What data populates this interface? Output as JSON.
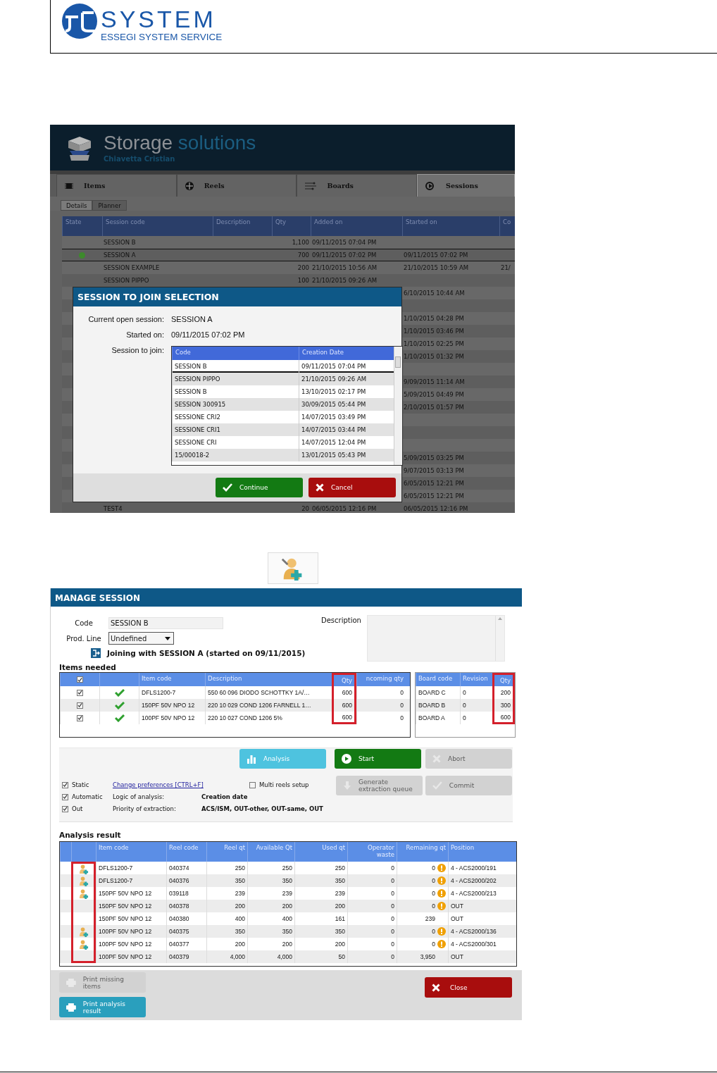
{
  "document_header": {
    "logo_wordmark": "SYSTEM",
    "logo_tagline": "ESSEGI SYSTEM SERVICE"
  },
  "storage_app": {
    "title_main": "Storage",
    "title_accent": "solutions",
    "user": "Chiavetta Cristian",
    "tabs": [
      {
        "label": "Items",
        "selected": false
      },
      {
        "label": "Reels",
        "selected": false
      },
      {
        "label": "Boards",
        "selected": false
      },
      {
        "label": "Sessions",
        "selected": true
      }
    ],
    "subtabs": [
      {
        "label": "Details",
        "selected": true
      },
      {
        "label": "Planner",
        "selected": false
      }
    ],
    "sessions_table": {
      "columns": [
        "State",
        "Session code",
        "Description",
        "Qty",
        "Added on",
        "Started on",
        "Co"
      ],
      "rows": [
        {
          "active": false,
          "code": "SESSION B",
          "qty": "1,100",
          "added": "09/11/2015 07:04 PM"
        },
        {
          "active": true,
          "code": "SESSION A",
          "qty": "700",
          "added": "09/11/2015 07:02 PM",
          "started": "09/11/2015 07:02 PM"
        },
        {
          "active": false,
          "code": "SESSION EXAMPLE",
          "qty": "200",
          "added": "21/10/2015 10:56 AM",
          "started": "21/10/2015 10:59 AM",
          "column_7": "21/"
        },
        {
          "active": false,
          "code": "SESSION PIPPO",
          "qty": "100",
          "added": "21/10/2015 09:26 AM"
        },
        {
          "started": "6/10/2015 10:44 AM"
        },
        {},
        {
          "started": "1/10/2015 04:28 PM"
        },
        {
          "started": "1/10/2015 03:46 PM"
        },
        {
          "started": "1/10/2015 02:25 PM"
        },
        {
          "started": "1/10/2015 01:32 PM"
        },
        {},
        {
          "started": "9/09/2015 11:14 AM"
        },
        {
          "started": "5/09/2015 04:49 PM"
        },
        {
          "started": "2/10/2015 01:57 PM"
        },
        {},
        {},
        {},
        {
          "started": "5/09/2015 03:25 PM"
        },
        {
          "started": "9/07/2015 03:13 PM"
        },
        {
          "started": "6/05/2015 12:21 PM"
        },
        {
          "started": "6/05/2015 12:21 PM"
        },
        {
          "active": false,
          "code": "TEST4",
          "qty": "20",
          "added": "06/05/2015 12:16 PM",
          "started": "06/05/2015 12:16 PM"
        }
      ]
    },
    "dialog": {
      "title": "SESSION TO JOIN SELECTION",
      "current_label": "Current open session:",
      "current_value": "SESSION A",
      "started_label": "Started on:",
      "started_value": "09/11/2015 07:02 PM",
      "join_label": "Session to join:",
      "list_columns": [
        "Code",
        "Creation Date"
      ],
      "list_rows": [
        {
          "code": "SESSION B",
          "date": "09/11/2015 07:04 PM",
          "selected": true
        },
        {
          "code": "SESSION PIPPO",
          "date": "21/10/2015 09:26 AM",
          "selected": false
        },
        {
          "code": "SESSION B",
          "date": "13/10/2015 02:17 PM",
          "selected": false
        },
        {
          "code": "SESSION 300915",
          "date": "30/09/2015 05:44 PM",
          "selected": false
        },
        {
          "code": "SESSIONE CRI2",
          "date": "14/07/2015 03:49 PM",
          "selected": false
        },
        {
          "code": "SESSIONE CRI1",
          "date": "14/07/2015 03:44 PM",
          "selected": false
        },
        {
          "code": "SESSIONE CRI",
          "date": "14/07/2015 12:04 PM",
          "selected": false
        },
        {
          "code": "15/00018-2",
          "date": "13/01/2015 05:43 PM",
          "selected": false
        }
      ],
      "buttons": [
        {
          "label": "Continue",
          "kind": "continue"
        },
        {
          "label": "Cancel",
          "kind": "cancel"
        }
      ]
    }
  },
  "manage_session": {
    "title": "MANAGE SESSION",
    "code_label": "Code",
    "code_value": "SESSION B",
    "prod_line_label": "Prod. Line",
    "prod_line_value": "Undefined",
    "description_label": "Description",
    "joining_text": "Joining with SESSION A (started on 09/11/2015)",
    "items_heading": "Items needed",
    "items_table": {
      "header_checked": true,
      "columns": [
        {
          "label": "Item code",
          "highlighted": false
        },
        {
          "label": "Description",
          "highlighted": false
        },
        {
          "label": "Qty",
          "highlighted": true
        },
        {
          "label": "ncoming qty",
          "highlighted": false
        }
      ],
      "rows": [
        {
          "checked": true,
          "available": true,
          "item_code": "DFLS1200-7",
          "description": "550 60 096 DIODO SCHOTTKY 1A/…",
          "qty": "600",
          "incoming": "0"
        },
        {
          "checked": true,
          "available": true,
          "item_code": "150PF 50V NPO 12",
          "description": "220 10 029 COND 1206 FARNELL 1…",
          "qty": "600",
          "incoming": "0"
        },
        {
          "checked": true,
          "available": true,
          "item_code": "100PF 50V NPO 12",
          "description": "220 10 027 COND 1206 5%",
          "qty": "600",
          "incoming": "0"
        }
      ]
    },
    "boards_table": {
      "columns": [
        {
          "label": "Board code",
          "highlighted": false
        },
        {
          "label": "Revision",
          "highlighted": false
        },
        {
          "label": "Qty",
          "highlighted": true
        }
      ],
      "rows": [
        {
          "code": "BOARD C",
          "revision": "0",
          "qty": "200"
        },
        {
          "code": "BOARD B",
          "revision": "0",
          "qty": "300"
        },
        {
          "code": "BOARD A",
          "revision": "0",
          "qty": "600"
        }
      ]
    },
    "action_buttons": [
      {
        "label": "Analysis",
        "kind": "analysis",
        "disabled": false
      },
      {
        "label": "Start",
        "kind": "start",
        "disabled": false
      },
      {
        "label": "Abort",
        "kind": "abort",
        "disabled": true
      }
    ],
    "queue_buttons": [
      {
        "label": "Generate extraction queue",
        "kind": "generate",
        "disabled": true
      },
      {
        "label": "Commit",
        "kind": "commit",
        "disabled": true
      }
    ],
    "options": [
      {
        "label": "Static",
        "checked": true
      },
      {
        "label": "Automatic",
        "checked": true
      },
      {
        "label": "Out",
        "checked": true
      }
    ],
    "preferences_link": "Change preferences  [CTRL+F]",
    "multi_reels": {
      "label": "Multi reels setup",
      "checked": false
    },
    "logic_label": "Logic of analysis:",
    "logic_value": "Creation date",
    "priority_label": "Priority of extraction:",
    "priority_value": "ACS/ISM, OUT-other, OUT-same, OUT",
    "analysis_heading": "Analysis result",
    "analysis_table": {
      "marker_column_highlighted": true,
      "columns": [
        "Item code",
        "Reel code",
        "Reel qt",
        "Available Qt",
        "Used qt",
        "Operator waste",
        "Remaining qt",
        "Position"
      ],
      "rows": [
        {
          "operator": true,
          "item_code": "DFLS1200-7",
          "reel_code": "040374",
          "reel_qt": "250",
          "available_qt": "250",
          "used_qt": "250",
          "waste": "0",
          "remaining": "0",
          "warning": true,
          "position": "4 - ACS2000/191"
        },
        {
          "operator": true,
          "item_code": "DFLS1200-7",
          "reel_code": "040376",
          "reel_qt": "350",
          "available_qt": "350",
          "used_qt": "350",
          "waste": "0",
          "remaining": "0",
          "warning": true,
          "position": "4 - ACS2000/202"
        },
        {
          "operator": true,
          "item_code": "150PF 50V NPO 12",
          "reel_code": "039118",
          "reel_qt": "239",
          "available_qt": "239",
          "used_qt": "239",
          "waste": "0",
          "remaining": "0",
          "warning": true,
          "position": "4 - ACS2000/213"
        },
        {
          "operator": false,
          "item_code": "150PF 50V NPO 12",
          "reel_code": "040378",
          "reel_qt": "200",
          "available_qt": "200",
          "used_qt": "200",
          "waste": "0",
          "remaining": "0",
          "warning": true,
          "position": "OUT"
        },
        {
          "operator": false,
          "item_code": "150PF 50V NPO 12",
          "reel_code": "040380",
          "reel_qt": "400",
          "available_qt": "400",
          "used_qt": "161",
          "waste": "0",
          "remaining": "239",
          "warning": false,
          "position": "OUT"
        },
        {
          "operator": true,
          "item_code": "100PF 50V NPO 12",
          "reel_code": "040375",
          "reel_qt": "350",
          "available_qt": "350",
          "used_qt": "350",
          "waste": "0",
          "remaining": "0",
          "warning": true,
          "position": "4 - ACS2000/136"
        },
        {
          "operator": true,
          "item_code": "100PF 50V NPO 12",
          "reel_code": "040377",
          "reel_qt": "200",
          "available_qt": "200",
          "used_qt": "200",
          "waste": "0",
          "remaining": "0",
          "warning": true,
          "position": "4 - ACS2000/301"
        },
        {
          "operator": false,
          "item_code": "100PF 50V NPO 12",
          "reel_code": "040379",
          "reel_qt": "4,000",
          "available_qt": "4,000",
          "used_qt": "50",
          "waste": "0",
          "remaining": "3,950",
          "warning": false,
          "position": "OUT"
        }
      ]
    },
    "footer_buttons": [
      {
        "label": "Print missing items",
        "kind": "print",
        "disabled": true
      },
      {
        "label": "Print analysis result",
        "kind": "print",
        "disabled": false
      }
    ],
    "close_button": {
      "label": "Close",
      "kind": "close"
    }
  }
}
